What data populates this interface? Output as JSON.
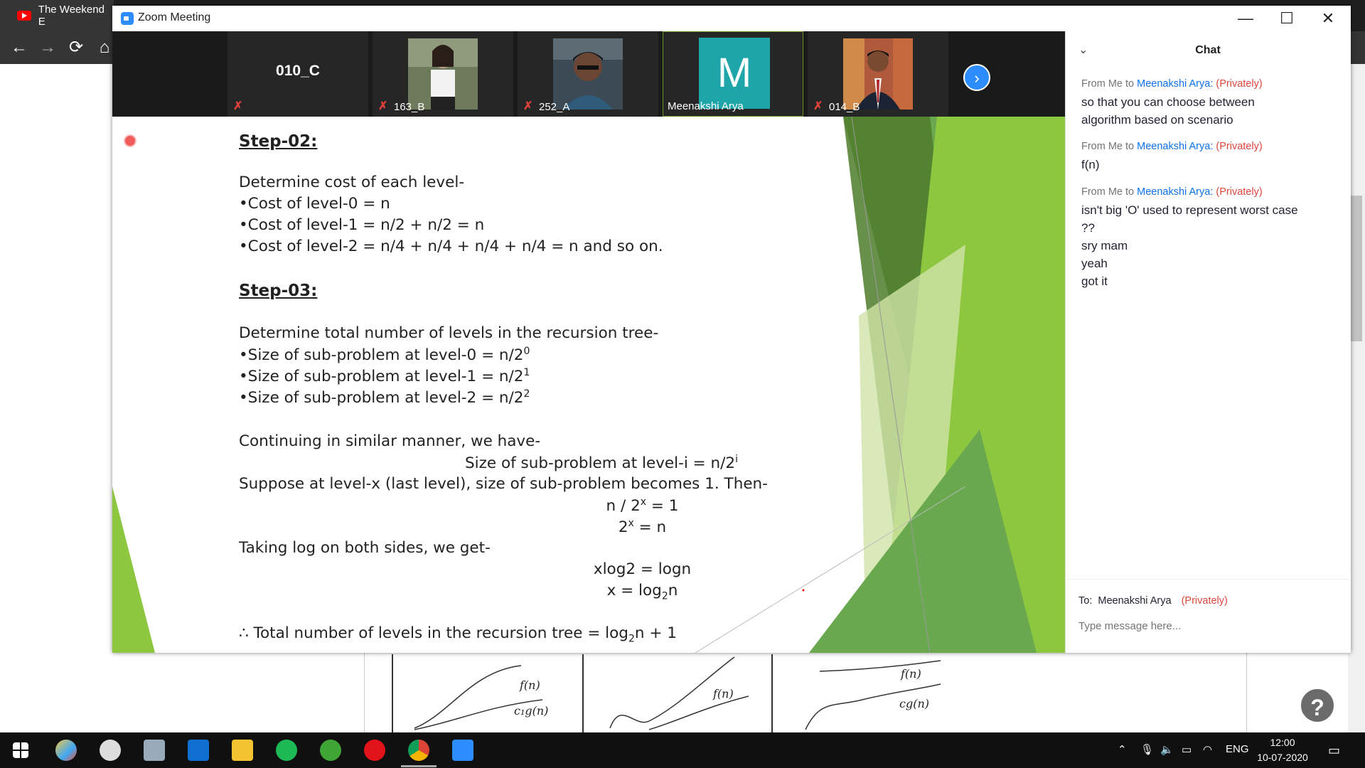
{
  "browser": {
    "tab_title": "The Weekend E",
    "nav": {
      "back": "←",
      "forward": "→",
      "reload": "⟳",
      "home": "⌂"
    }
  },
  "window": {
    "title": "Zoom Meeting",
    "minimize": "—",
    "maximize": "☐",
    "close": "✕"
  },
  "participants": [
    {
      "name": "010_C",
      "muted": true,
      "kind": "name-only"
    },
    {
      "name": "163_B",
      "muted": true,
      "kind": "photo"
    },
    {
      "name": "252_A",
      "muted": true,
      "kind": "photo"
    },
    {
      "name": "Meenakshi Arya",
      "muted": false,
      "kind": "avatar",
      "initial": "M",
      "avatar_color": "#1ea5a9"
    },
    {
      "name": "014_B",
      "muted": true,
      "kind": "photo"
    }
  ],
  "slide": {
    "step2_heading": "Step-02:",
    "step2_lines": [
      "Determine cost of each level-",
      "•Cost of level-0 = n",
      "•Cost of level-1 = n/2 + n/2 = n",
      "•Cost of level-2 = n/4 + n/4 + n/4 + n/4 = n and so on."
    ],
    "step3_heading": "Step-03:",
    "step3_intro": "Determine total number of levels in the recursion tree-",
    "size_lines": [
      {
        "text": "•Size of sub-problem at level-0 = n/2",
        "sup": "0"
      },
      {
        "text": "•Size of sub-problem at level-1 = n/2",
        "sup": "1"
      },
      {
        "text": "•Size of sub-problem at level-2 = n/2",
        "sup": "2"
      }
    ],
    "continuing": "Continuing in similar manner, we have-",
    "general": {
      "text": "Size of sub-problem at level-i = n/2",
      "sup": "i"
    },
    "suppose": "Suppose at level-x (last level), size of sub-problem becomes 1. Then-",
    "eq1": {
      "pre": "n / 2",
      "sup": "x",
      "post": " = 1"
    },
    "eq2": {
      "pre": "2",
      "sup": "x",
      "post": " = n"
    },
    "taking_log": "Taking log on both sides, we get-",
    "eq3": "xlog2 = logn",
    "eq4": {
      "pre": "x = log",
      "sub": "2",
      "post": "n"
    },
    "conclusion": {
      "pre": "∴ Total number of levels in the recursion tree = log",
      "sub": "2",
      "post": "n + 1"
    },
    "accent_colors": [
      "#8dc63f",
      "#6aa84f",
      "#4f7d2b",
      "#cfe4a8"
    ]
  },
  "chat": {
    "title": "Chat",
    "messages": [
      {
        "from": "From Me to ",
        "to": "Meenakshi Arya:",
        "privately": "(Privately)",
        "lines": [
          "so that you can choose between",
          "algorithm based on scenario"
        ]
      },
      {
        "from": "From Me to ",
        "to": "Meenakshi Arya:",
        "privately": "(Privately)",
        "lines": [
          "f(n)"
        ]
      },
      {
        "from": "From Me to ",
        "to": "Meenakshi Arya:",
        "privately": "(Privately)",
        "lines": [
          "isn't big 'O' used to represent worst case",
          "??",
          "sry mam",
          "yeah",
          "got it"
        ]
      }
    ],
    "to_label": "To:",
    "to_name": "Meenakshi Arya",
    "to_privately": "(Privately)",
    "input_placeholder": "Type message here..."
  },
  "background_figure": {
    "labels": [
      "f(n)",
      "c₁g(n)",
      "f(n)",
      "f(n)",
      "cg(n)"
    ]
  },
  "taskbar": {
    "language": "ENG",
    "time": "12:00",
    "date": "10-07-2020",
    "help": "?"
  }
}
